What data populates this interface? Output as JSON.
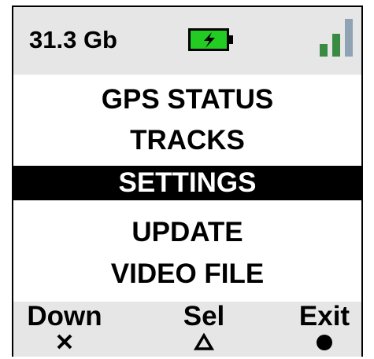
{
  "status_bar": {
    "storage": "31.3 Gb",
    "battery_icon": "battery-charging-icon",
    "signal_icon": "signal-strength-icon",
    "battery_color": "#22cc22",
    "signal_color": "#3a8a44"
  },
  "menu": {
    "items": [
      {
        "label": "GPS STATUS",
        "selected": false
      },
      {
        "label": "TRACKS",
        "selected": false
      },
      {
        "label": "SETTINGS",
        "selected": true
      },
      {
        "label": "UPDATE",
        "selected": false
      },
      {
        "label": "VIDEO FILE",
        "selected": false
      }
    ]
  },
  "softkeys": {
    "down": {
      "label": "Down",
      "icon": "cross-icon"
    },
    "select": {
      "label": "Sel",
      "icon": "triangle-icon"
    },
    "exit": {
      "label": "Exit",
      "icon": "circle-icon"
    }
  }
}
